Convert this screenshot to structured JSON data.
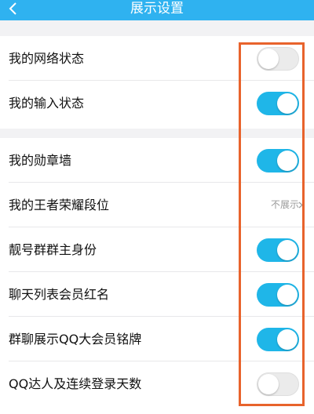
{
  "header": {
    "title": "展示设置",
    "back_icon": "chevron-left-icon",
    "background_color": "#2fb2f0"
  },
  "settings": [
    {
      "label": "我的网络状态",
      "control": "toggle",
      "on": false
    },
    {
      "label": "我的输入状态",
      "control": "toggle",
      "on": true
    },
    {
      "label": "我的勋章墙",
      "control": "toggle",
      "on": true
    },
    {
      "label": "我的王者荣耀段位",
      "control": "link",
      "value": "不展示"
    },
    {
      "label": "靓号群群主身份",
      "control": "toggle",
      "on": true
    },
    {
      "label": "聊天列表会员红名",
      "control": "toggle",
      "on": true
    },
    {
      "label": "群聊展示QQ大会员铭牌",
      "control": "toggle",
      "on": true
    },
    {
      "label": "QQ达人及连续登录天数",
      "control": "toggle",
      "on": false
    }
  ],
  "colors": {
    "toggle_on": "#1fb6e8",
    "toggle_off": "#ebebeb",
    "highlight": "#e8632c"
  }
}
